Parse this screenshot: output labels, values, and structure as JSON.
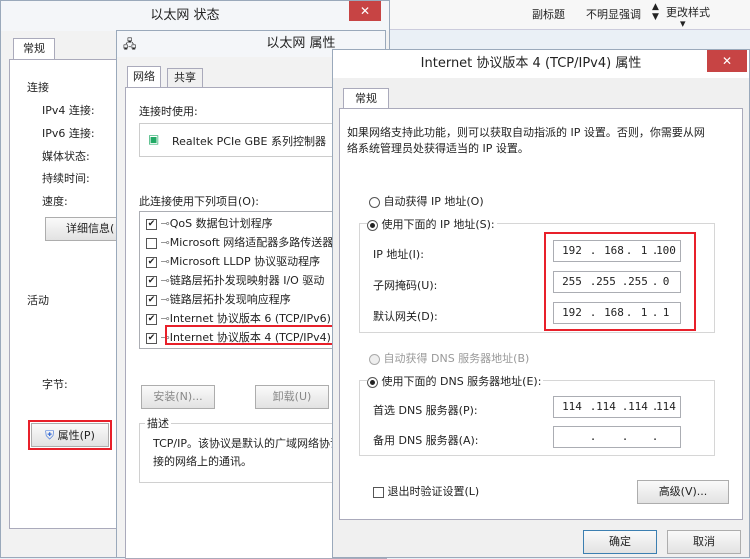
{
  "ribbon": {
    "style_subtitle": "副标题",
    "style_subtle_emphasis": "不明显强调",
    "change_styles": "更改样式",
    "change_styles_arrow": "▾"
  },
  "status_window": {
    "title": "以太网 状态",
    "close": "✕",
    "tab_general": "常规",
    "section_connection": "连接",
    "ipv4": "IPv4 连接:",
    "ipv6": "IPv6 连接:",
    "media_state": "媒体状态:",
    "duration": "持续时间:",
    "speed": "速度:",
    "details_button": "详细信息(",
    "section_activity": "活动",
    "bytes": "字节:",
    "properties_button": "属性(P)"
  },
  "props_window": {
    "title": "以太网 属性",
    "tab_network": "网络",
    "tab_sharing": "共享",
    "connect_using": "连接时使用:",
    "adapter": "Realtek PCIe GBE 系列控制器",
    "items_label": "此连接使用下列项目(O):",
    "items": [
      {
        "checked": "✔",
        "text": "QoS 数据包计划程序"
      },
      {
        "checked": "",
        "text": "Microsoft 网络适配器多路传送器"
      },
      {
        "checked": "✔",
        "text": "Microsoft LLDP 协议驱动程序"
      },
      {
        "checked": "✔",
        "text": "链路层拓扑发现映射器 I/O 驱动"
      },
      {
        "checked": "✔",
        "text": "链路层拓扑发现响应程序"
      },
      {
        "checked": "✔",
        "text": "Internet 协议版本 6 (TCP/IPv6)"
      },
      {
        "checked": "✔",
        "text": "Internet 协议版本 4 (TCP/IPv4)"
      }
    ],
    "install_button": "安装(N)...",
    "uninstall_button": "卸载(U)",
    "description_label": "描述",
    "description_text1": "TCP/IP。该协议是默认的广域网络协议",
    "description_text2": "接的网络上的通讯。"
  },
  "ipv4_dialog": {
    "title": "Internet 协议版本 4 (TCP/IPv4) 属性",
    "close": "✕",
    "tab_general": "常规",
    "intro1": "如果网络支持此功能，则可以获取自动指派的 IP 设置。否则，你需要从网",
    "intro2": "络系统管理员处获得适当的 IP 设置。",
    "auto_ip": "自动获得 IP 地址(O)",
    "manual_ip": "使用下面的 IP 地址(S):",
    "ip_label": "IP 地址(I):",
    "ip": [
      "192",
      "168",
      "1",
      "100"
    ],
    "mask_label": "子网掩码(U):",
    "mask": [
      "255",
      "255",
      "255",
      "0"
    ],
    "gateway_label": "默认网关(D):",
    "gateway": [
      "192",
      "168",
      "1",
      "1"
    ],
    "auto_dns": "自动获得 DNS 服务器地址(B)",
    "manual_dns": "使用下面的 DNS 服务器地址(E):",
    "preferred_dns_label": "首选 DNS 服务器(P):",
    "preferred_dns": [
      "114",
      "114",
      "114",
      "114"
    ],
    "alternate_dns_label": "备用 DNS 服务器(A):",
    "alternate_dns": [
      "",
      "",
      "",
      ""
    ],
    "validate_on_exit": "退出时验证设置(L)",
    "advanced_button": "高级(V)...",
    "ok_button": "确定",
    "cancel_button": "取消"
  },
  "colors": {
    "highlight_red": "#e8202a",
    "title_bg": "#f4f6f9",
    "close_red": "#c74444"
  }
}
